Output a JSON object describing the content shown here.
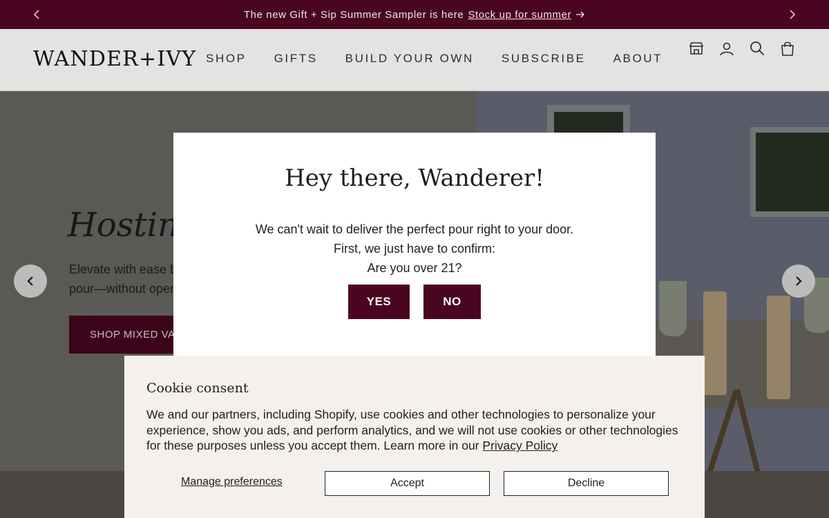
{
  "announcement": {
    "text": "The new Gift + Sip Summer Sampler is here",
    "link": "Stock up for summer"
  },
  "header": {
    "logo": "WANDER+IVY",
    "nav": [
      "SHOP",
      "GIFTS",
      "BUILD YOUR OWN",
      "SUBSCRIBE",
      "ABOUT"
    ],
    "icons": [
      "store-icon",
      "account-icon",
      "search-icon",
      "bag-icon"
    ]
  },
  "hero": {
    "title": "Hosting",
    "description_line1": "Elevate with ease by",
    "description_line2": "pour—without oper",
    "cta": "SHOP MIXED VAR"
  },
  "age_gate": {
    "title": "Hey there, Wanderer!",
    "line1": "We can't wait to deliver the perfect pour right to your door.",
    "line2": "First, we just have to confirm:",
    "line3": "Are you over 21?",
    "yes": "YES",
    "no": "NO"
  },
  "cookie": {
    "title": "Cookie consent",
    "text": "We and our partners, including Shopify, use cookies and other technologies to personalize your experience, show you ads, and perform analytics, and we will not use cookies or other technologies for these purposes unless you accept them. Learn more in our",
    "privacy_link": "Privacy Policy",
    "manage": "Manage preferences",
    "accept": "Accept",
    "decline": "Decline"
  },
  "colors": {
    "brand": "#4a0520",
    "header_bg": "#e4e3e1",
    "cookie_bg": "#f3f0ed"
  }
}
